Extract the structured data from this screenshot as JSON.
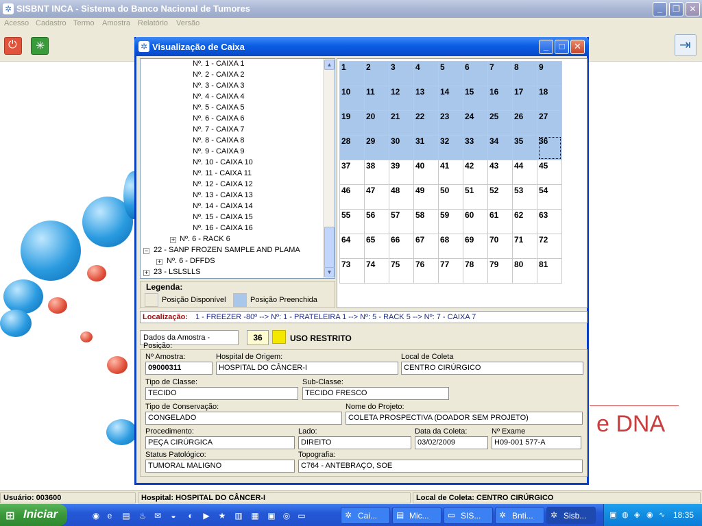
{
  "app": {
    "title": "SISBNT INCA - Sistema do Banco Nacional de Tumores",
    "menu": [
      "Acesso",
      "Cadastro",
      "Termo",
      "Amostra",
      "Relatório",
      "Versão"
    ]
  },
  "window_buttons": {
    "minimize": "_",
    "restore": "❐",
    "close": "✕"
  },
  "dialog": {
    "title": "Visualização de Caixa",
    "tree": {
      "items": [
        {
          "label": "Nº. 1 - CAIXA 1"
        },
        {
          "label": "Nº. 2 - CAIXA 2"
        },
        {
          "label": "Nº. 3 - CAIXA 3"
        },
        {
          "label": "Nº. 4 - CAIXA 4"
        },
        {
          "label": "Nº. 5 - CAIXA 5"
        },
        {
          "label": "Nº. 6 - CAIXA 6"
        },
        {
          "label": "Nº. 7 - CAIXA 7"
        },
        {
          "label": "Nº. 8 - CAIXA 8"
        },
        {
          "label": "Nº. 9 - CAIXA 9"
        },
        {
          "label": "Nº. 10 - CAIXA 10"
        },
        {
          "label": "Nº. 11 - CAIXA 11"
        },
        {
          "label": "Nº. 12 - CAIXA 12"
        },
        {
          "label": "Nº. 13 - CAIXA 13"
        },
        {
          "label": "Nº. 14 - CAIXA 14"
        },
        {
          "label": "Nº. 15 - CAIXA 15"
        },
        {
          "label": "Nº. 16 - CAIXA 16"
        },
        {
          "label": "Nº. 6 - RACK 6",
          "expander": "+"
        },
        {
          "label": "22 - SANP FROZEN SAMPLE AND PLAMA",
          "expander": "−"
        },
        {
          "label": "Nº. 6 - DFFDS",
          "expander": "+"
        },
        {
          "label": "23 - LSLSLLS",
          "expander": "+"
        }
      ]
    },
    "legend": {
      "title": "Legenda:",
      "available": "Posição Disponível",
      "filled": "Posição Preenchida",
      "available_color": "#ffffff",
      "filled_color": "#a9c7ea"
    },
    "grid": {
      "cells": [
        "1",
        "2",
        "3",
        "4",
        "5",
        "6",
        "7",
        "8",
        "9",
        "10",
        "11",
        "12",
        "13",
        "14",
        "15",
        "16",
        "17",
        "18",
        "19",
        "20",
        "21",
        "22",
        "23",
        "24",
        "25",
        "26",
        "27",
        "28",
        "29",
        "30",
        "31",
        "32",
        "33",
        "34",
        "35",
        "36",
        "37",
        "38",
        "39",
        "40",
        "41",
        "42",
        "43",
        "44",
        "45",
        "46",
        "47",
        "48",
        "49",
        "50",
        "51",
        "52",
        "53",
        "54",
        "55",
        "56",
        "57",
        "58",
        "59",
        "60",
        "61",
        "62",
        "63",
        "64",
        "65",
        "66",
        "67",
        "68",
        "69",
        "70",
        "71",
        "72",
        "73",
        "74",
        "75",
        "76",
        "77",
        "78",
        "79",
        "80",
        "81"
      ],
      "filled_count": 36,
      "selected": 36
    },
    "location": {
      "label": "Localização:",
      "value": "1 - FREEZER -80º --> Nº: 1 - PRATELEIRA 1 --> Nº: 5 - RACK 5 --> Nº: 7 - CAIXA 7"
    },
    "sample": {
      "position_label": "Dados da Amostra - Posição:",
      "position_value": "36",
      "restricted": "USO RESTRITO"
    },
    "form": {
      "n_amostra_label": "Nº Amostra:",
      "n_amostra": "09000311",
      "hospital_origem_label": "Hospital de Origem:",
      "hospital_origem": "HOSPITAL DO CÂNCER-I",
      "local_coleta_label": "Local de Coleta",
      "local_coleta": "CENTRO CIRÚRGICO",
      "tipo_classe_label": "Tipo de Classe:",
      "tipo_classe": "TECIDO",
      "sub_classe_label": "Sub-Classe:",
      "sub_classe": "TECIDO FRESCO",
      "tipo_conservacao_label": "Tipo de Conservação:",
      "tipo_conservacao": "CONGELADO",
      "nome_projeto_label": "Nome do Projeto:",
      "nome_projeto": "COLETA PROSPECTIVA (DOADOR SEM PROJETO)",
      "procedimento_label": "Procedimento:",
      "procedimento": "PEÇA CIRÚRGICA",
      "lado_label": "Lado:",
      "lado": "DIREITO",
      "data_coleta_label": "Data da Coleta:",
      "data_coleta": "03/02/2009",
      "n_exame_label": "Nº Exame",
      "n_exame": "H09-001 577-A",
      "status_patologico_label": "Status Patológico:",
      "status_patologico": "TUMORAL MALIGNO",
      "topografia_label": "Topografia:",
      "topografia": "C764 - ANTEBRAÇO, SOE"
    }
  },
  "background_text": "e DNA",
  "statusbar": {
    "user": "Usuário: 003600",
    "hospital": "Hospital: HOSPITAL DO CÂNCER-I",
    "local": "Local de Coleta: CENTRO CIRÚRGICO"
  },
  "taskbar": {
    "start": "Iniciar",
    "tasks": [
      "Cai...",
      "Mic...",
      "SIS...",
      "Bnti...",
      "Sisb..."
    ],
    "clock": "18:35"
  }
}
